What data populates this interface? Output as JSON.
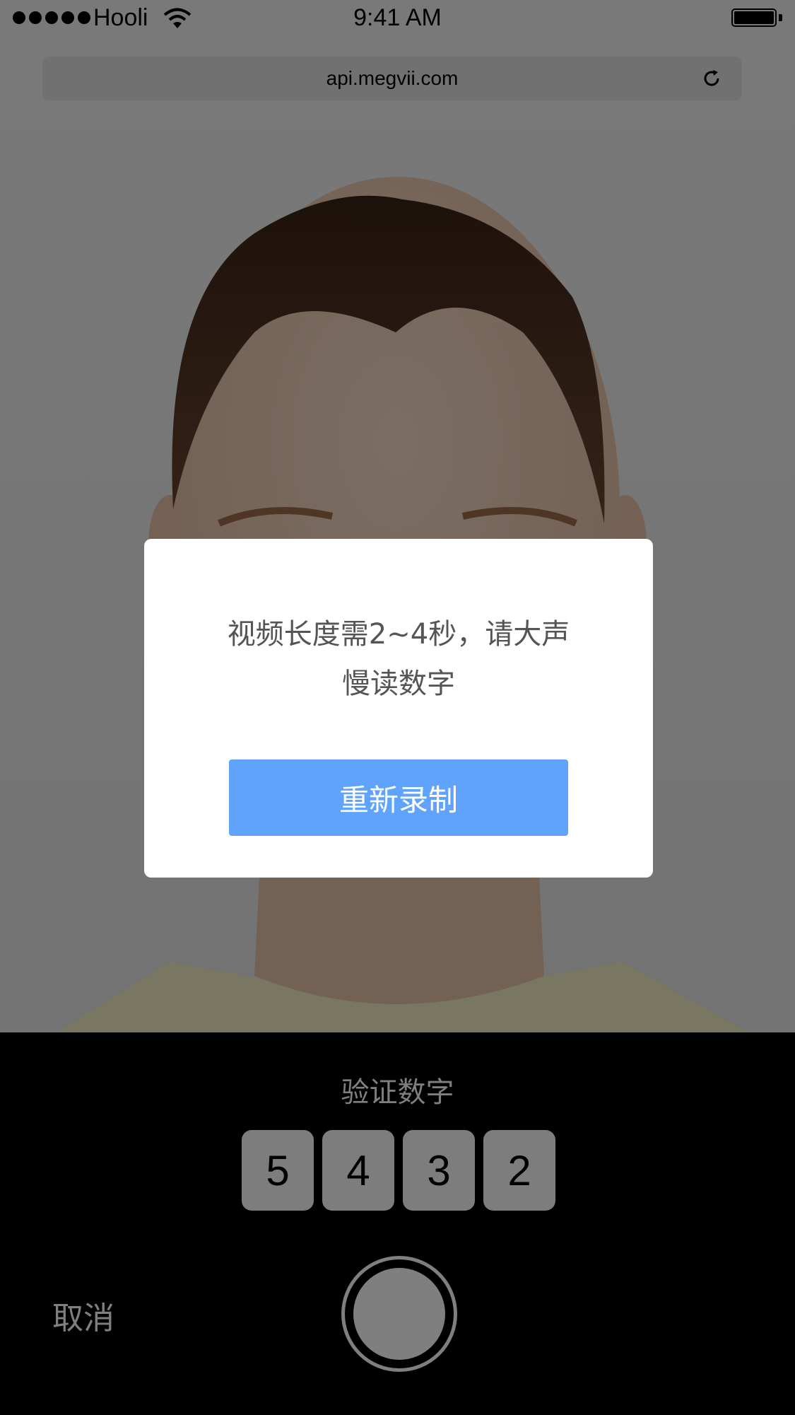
{
  "status_bar": {
    "carrier": "Hooli",
    "time": "9:41 AM",
    "signal_icon": "signal-dots-icon",
    "wifi_icon": "wifi-icon",
    "battery_icon": "battery-icon"
  },
  "url_bar": {
    "url": "api.megvii.com",
    "reload_icon": "reload-icon"
  },
  "dialog": {
    "message_line1": "视频长度需2~4秒，请大声",
    "message_line2": "慢读数字",
    "retry_label": "重新录制"
  },
  "bottom": {
    "title": "验证数字",
    "digits": [
      "5",
      "4",
      "3",
      "2"
    ],
    "cancel_label": "取消",
    "shutter_icon": "shutter-record-icon"
  },
  "colors": {
    "primary_button": "#5fa3fc",
    "overlay": "rgba(0,0,0,0.5)"
  }
}
